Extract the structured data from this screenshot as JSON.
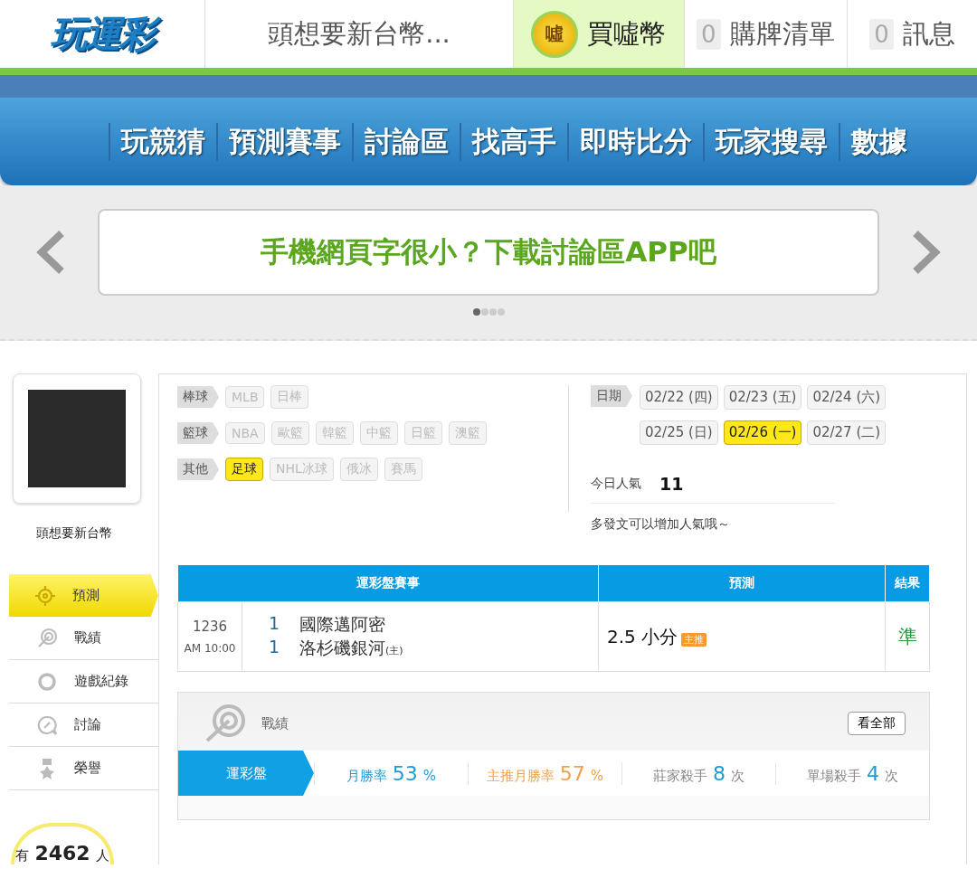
{
  "logo": "玩運彩",
  "header_tabs": [
    {
      "kind": "user",
      "label": "頭想要新台幣...",
      "selected": false
    },
    {
      "kind": "coin",
      "icon_text": "噓",
      "label": "買噓幣",
      "selected": true
    },
    {
      "kind": "count",
      "count": "0",
      "label": "購牌清單",
      "selected": false
    },
    {
      "kind": "count",
      "count": "0",
      "label": "訊息",
      "selected": false
    }
  ],
  "nav": [
    "玩競猜",
    "預測賽事",
    "討論區",
    "找高手",
    "即時比分",
    "玩家搜尋",
    "數據"
  ],
  "banner": {
    "text": "手機網頁字很小？下載討論區APP吧",
    "dots": [
      {
        "selected": true
      },
      {
        "selected": false
      },
      {
        "selected": false
      },
      {
        "selected": false
      }
    ]
  },
  "profile": {
    "name": "頭想要新台幣"
  },
  "side_menu": [
    {
      "kind": "target",
      "label": "預測",
      "selected": true
    },
    {
      "kind": "record",
      "label": "戰績",
      "selected": false
    },
    {
      "kind": "ring",
      "label": "遊戲紀錄",
      "selected": false
    },
    {
      "kind": "chat",
      "label": "討論",
      "selected": false
    },
    {
      "kind": "medal",
      "label": "榮譽",
      "selected": false
    }
  ],
  "online": {
    "prefix": "有",
    "count": "2462",
    "suffix": "人"
  },
  "filters": [
    {
      "label": "棒球",
      "options": [
        {
          "label": "MLB",
          "selected": false
        },
        {
          "label": "日棒",
          "selected": false
        }
      ]
    },
    {
      "label": "籃球",
      "options": [
        {
          "label": "NBA",
          "selected": false
        },
        {
          "label": "歐籃",
          "selected": false
        },
        {
          "label": "韓籃",
          "selected": false
        },
        {
          "label": "中籃",
          "selected": false
        },
        {
          "label": "日籃",
          "selected": false
        },
        {
          "label": "澳籃",
          "selected": false
        }
      ]
    },
    {
      "label": "其他",
      "options": [
        {
          "label": "足球",
          "selected": true
        },
        {
          "label": "NHL冰球",
          "selected": false
        },
        {
          "label": "俄冰",
          "selected": false
        },
        {
          "label": "賽馬",
          "selected": false
        }
      ]
    }
  ],
  "dates": {
    "label": "日期",
    "options": [
      {
        "label": "02/22 (四)",
        "selected": false
      },
      {
        "label": "02/23 (五)",
        "selected": false
      },
      {
        "label": "02/24 (六)",
        "selected": false
      },
      {
        "label": "02/25 (日)",
        "selected": false
      },
      {
        "label": "02/26 (一)",
        "selected": true
      },
      {
        "label": "02/27 (二)",
        "selected": false
      }
    ]
  },
  "popularity": {
    "label": "今日人氣",
    "value": "11",
    "note": "多發文可以增加人氣哦～"
  },
  "table": {
    "columns": [
      "運彩盤賽事",
      "預測",
      "結果"
    ],
    "rows": [
      {
        "number": "1236",
        "time": "AM 10:00",
        "teams": [
          {
            "score": "1",
            "name": "國際邁阿密"
          },
          {
            "score": "1",
            "name": "洛杉磯銀河",
            "note": "(主)"
          }
        ],
        "prediction": "2.5 小分",
        "tag": "主推",
        "result": "準"
      }
    ]
  },
  "record": {
    "title": "戰績",
    "button": "看全部",
    "tab": "運彩盤",
    "stats": [
      {
        "label": "月勝率",
        "value": "53",
        "unit": "%",
        "color": "#1e9ad6"
      },
      {
        "label": "主推月勝率",
        "value": "57",
        "unit": "%",
        "color": "#f0a04b"
      },
      {
        "label": "莊家殺手",
        "value": "8",
        "unit": "次",
        "color": "#888888"
      },
      {
        "label": "單場殺手",
        "value": "4",
        "unit": "次",
        "color": "#888888"
      }
    ]
  }
}
